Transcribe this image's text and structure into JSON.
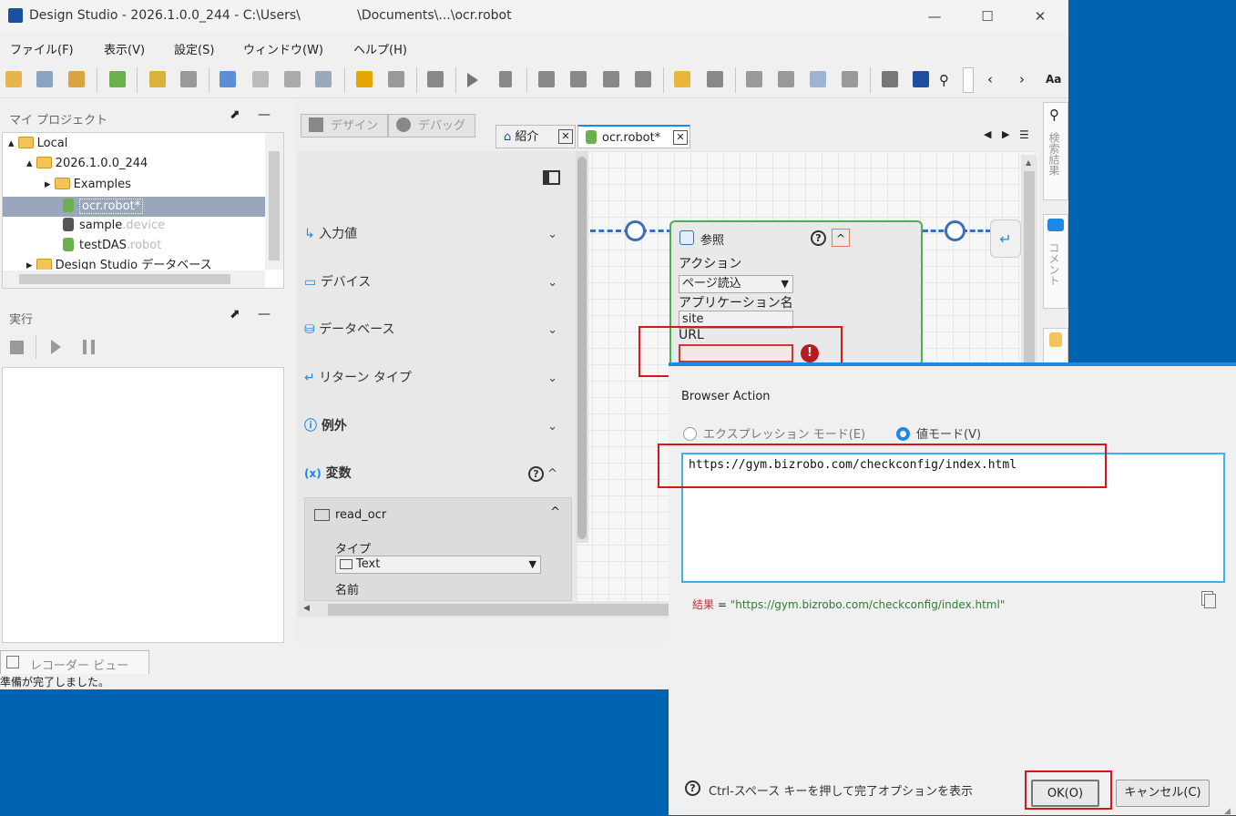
{
  "window": {
    "title": "Design Studio - 2026.1.0.0_244 - C:\\Users\\              \\Documents\\...\\ocr.robot"
  },
  "menu": [
    "ファイル(F)",
    "表示(V)",
    "設定(S)",
    "ウィンドウ(W)",
    "ヘルプ(H)"
  ],
  "project_panel": {
    "title": "マイ プロジェクト",
    "tree": [
      {
        "label": "Local",
        "suffix": ""
      },
      {
        "label": "2026.1.0.0_244",
        "suffix": ""
      },
      {
        "label": "Examples",
        "suffix": ""
      },
      {
        "label": "ocr.robot*",
        "suffix": ""
      },
      {
        "label": "sample",
        "suffix": ".device"
      },
      {
        "label": "testDAS",
        "suffix": ".robot"
      },
      {
        "label": "Design Studio データベース",
        "suffix": ""
      }
    ]
  },
  "run_panel": {
    "title": "実行"
  },
  "recorder_tab": "レコーダー ビュー",
  "status_bar": "準備が完了しました。",
  "mode_tabs": {
    "design": "デザイン",
    "debug": "デバッグ"
  },
  "editor_tabs": [
    {
      "label": "紹介"
    },
    {
      "label": "ocr.robot*"
    }
  ],
  "side_tabs": {
    "search": "検索結果",
    "comment": "コメント"
  },
  "properties": {
    "sections": [
      "入力値",
      "デバイス",
      "データベース",
      "リターン タイプ",
      "例外",
      "変数"
    ],
    "variable": {
      "name": "read_ocr",
      "type_label": "タイプ",
      "type_value": "Text",
      "name_label": "名前"
    }
  },
  "step": {
    "title": "参照",
    "action_label": "アクション",
    "action_value": "ページ読込",
    "app_label": "アプリケーション名",
    "app_value": "site",
    "url_label": "URL",
    "url_value": ""
  },
  "dialog": {
    "title": "Browser Action",
    "radio_expression": "エクスプレッション モード(E)",
    "radio_value": "値モード(V)",
    "text_value": "https://gym.bizrobo.com/checkconfig/index.html",
    "result_label": "結果",
    "result_eq": " = ",
    "result_value": "\"https://gym.bizrobo.com/checkconfig/index.html\"",
    "hint": "Ctrl-スペース キーを押して完了オプションを表示",
    "ok_label": "OK(O)",
    "cancel_label": "キャンセル(C)"
  },
  "colors": {
    "accent": "#1e88e5",
    "desktop": "#0063b1",
    "highlight": "#d81818",
    "step_border": "#4caf50"
  }
}
